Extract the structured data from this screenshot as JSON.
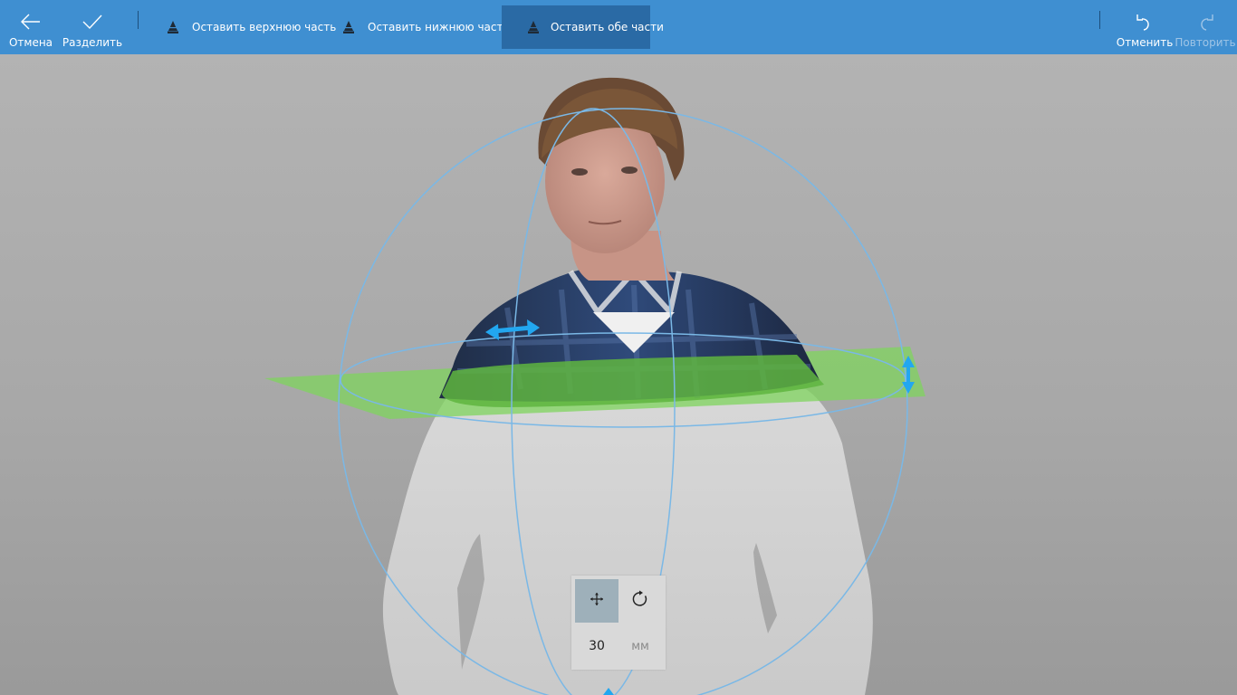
{
  "toolbar": {
    "cancel_label": "Отмена",
    "split_label": "Разделить",
    "options": [
      {
        "label": "Оставить верхнюю часть",
        "active": false
      },
      {
        "label": "Оставить нижнюю часть",
        "active": false
      },
      {
        "label": "Оставить обе части",
        "active": true
      }
    ],
    "undo_label": "Отменить",
    "redo_label": "Повторить"
  },
  "icons": {
    "cancel": "arrow-left-icon",
    "split": "checkmark-icon",
    "keep_top": "cone-top-icon",
    "keep_bottom": "cone-bottom-icon",
    "keep_both": "cone-both-icon",
    "undo": "undo-icon",
    "redo": "redo-icon",
    "move": "move-arrows-icon",
    "rotate": "rotate-icon"
  },
  "transform_panel": {
    "value": "30",
    "unit": "мм"
  },
  "colors": {
    "toolbar_bg": "#3f8fd1",
    "toolbar_active": "#2a6aa5",
    "cut_plane": "#7fd45e",
    "gizmo_handle": "#22a7f0",
    "gizmo_ring": "#7ab8e6"
  }
}
